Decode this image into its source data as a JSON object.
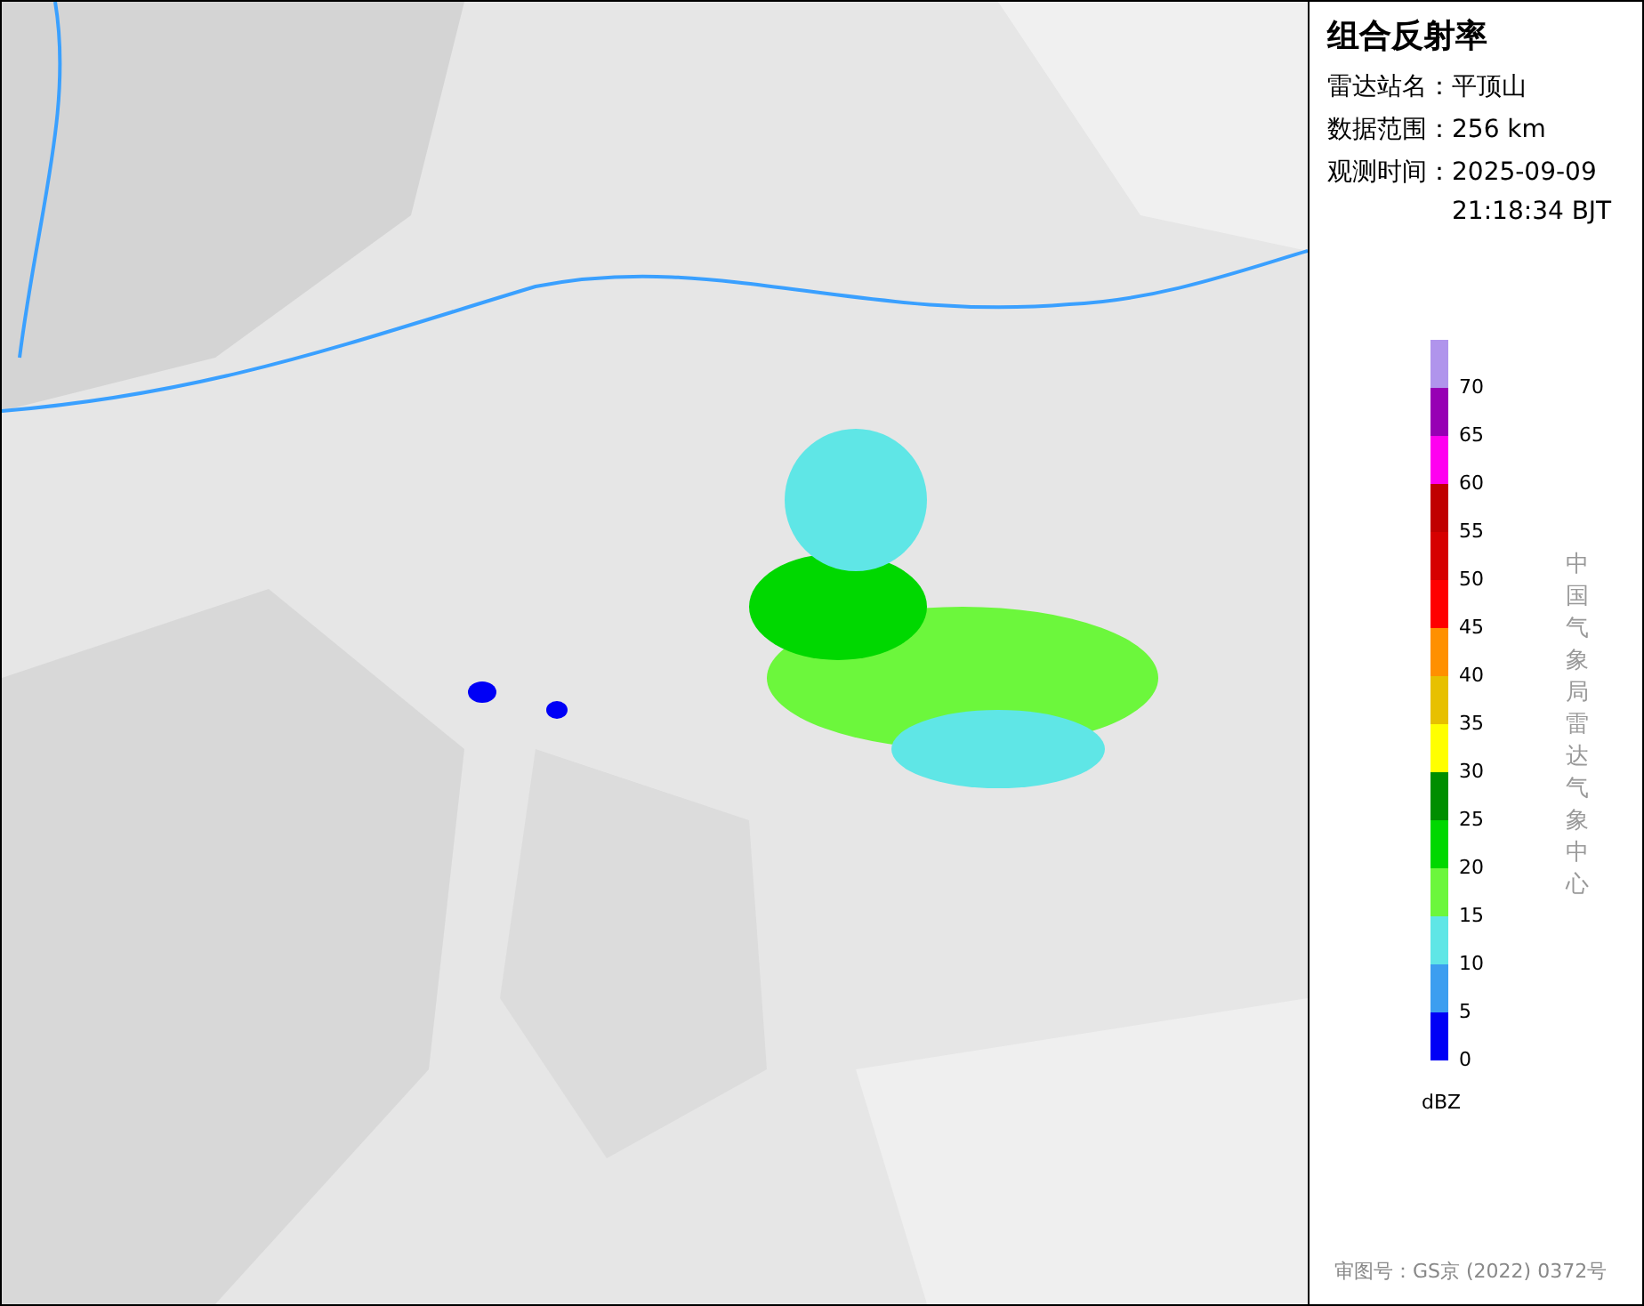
{
  "panel": {
    "title": "组合反射率",
    "rows": [
      {
        "label": "雷达站名：",
        "values": [
          "平顶山"
        ]
      },
      {
        "label": "数据范围：",
        "values": [
          "256 km"
        ]
      },
      {
        "label": "观测时间：",
        "values": [
          "2025-09-09",
          "21:18:34 BJT"
        ]
      }
    ]
  },
  "legend": {
    "unit": "dBZ",
    "items": [
      {
        "label": "70",
        "color": "#b094ec"
      },
      {
        "label": "65",
        "color": "#9700b4"
      },
      {
        "label": "60",
        "color": "#ff00f0"
      },
      {
        "label": "55",
        "color": "#c00000"
      },
      {
        "label": "50",
        "color": "#d60000"
      },
      {
        "label": "45",
        "color": "#ff0000"
      },
      {
        "label": "40",
        "color": "#ff9000"
      },
      {
        "label": "35",
        "color": "#e7c000"
      },
      {
        "label": "30",
        "color": "#ffff00"
      },
      {
        "label": "25",
        "color": "#008e00"
      },
      {
        "label": "20",
        "color": "#00d800"
      },
      {
        "label": "15",
        "color": "#6cf73c"
      },
      {
        "label": "10",
        "color": "#5fe6e6"
      },
      {
        "label": "5",
        "color": "#3c9ef0"
      },
      {
        "label": "0",
        "color": "#0000f6"
      }
    ]
  },
  "credit": "中国气象局雷达气象中心",
  "approval": "审图号：GS京 (2022) 0372号"
}
